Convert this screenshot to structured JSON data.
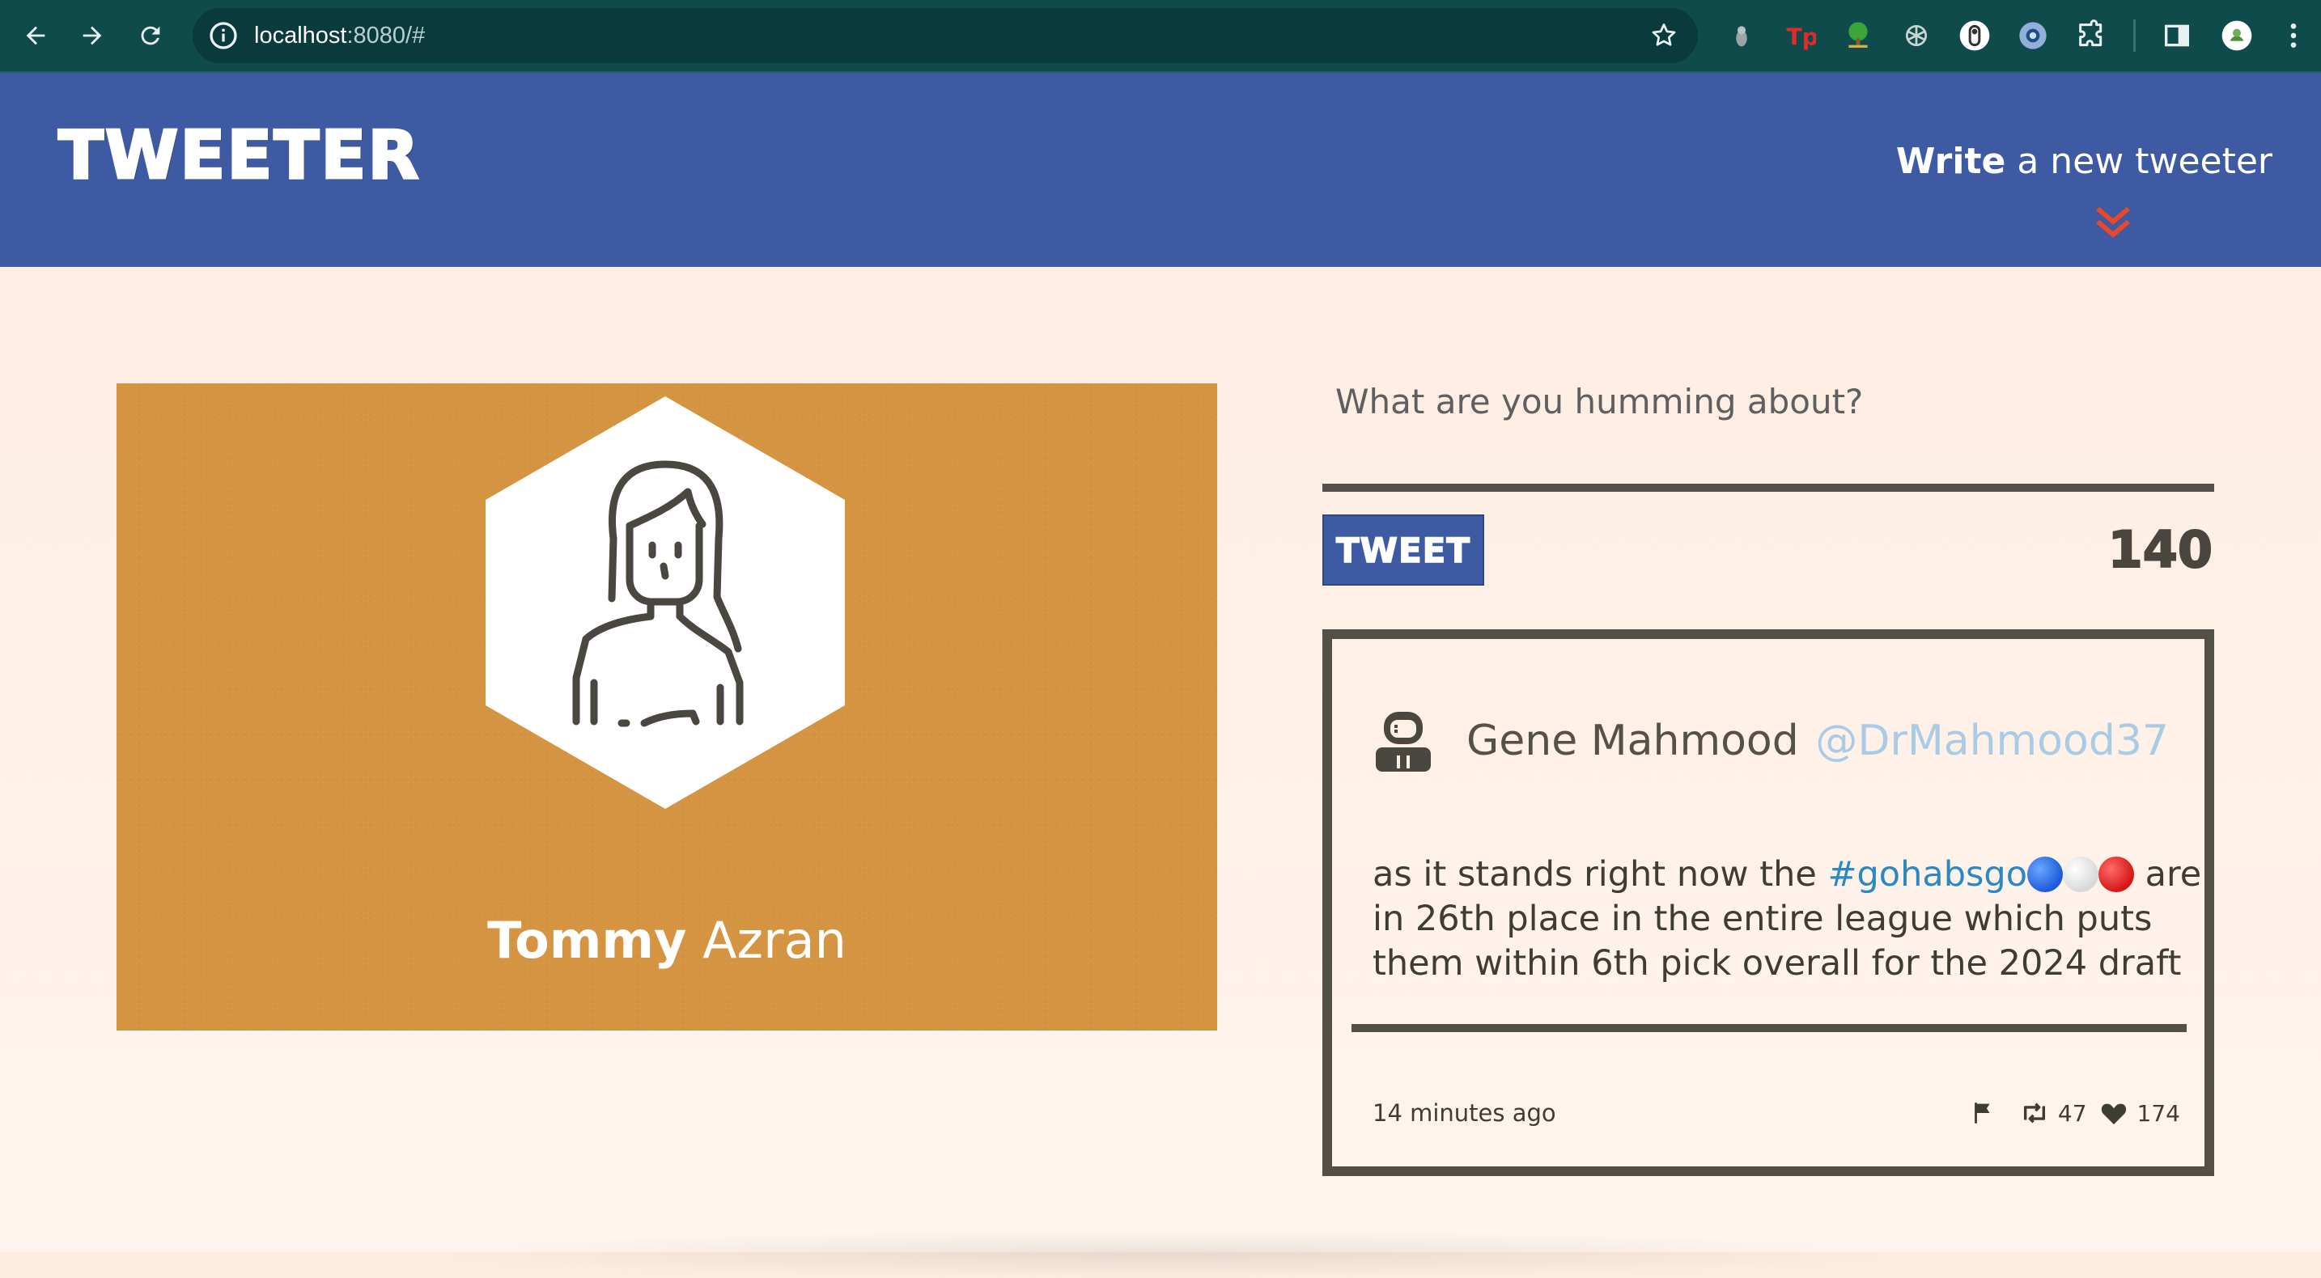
{
  "browser": {
    "url_host": "localhost",
    "url_rest": ":8080/#"
  },
  "header": {
    "logo": "TWEETER",
    "compose_toggle_bold": "Write",
    "compose_toggle_rest": " a new tweeter"
  },
  "profile": {
    "first_name": "Tommy",
    "last_name": "Azran",
    "background_color": "#d59441"
  },
  "compose": {
    "placeholder": "What are you humming about?",
    "button_label": "TWEET",
    "char_counter": "140"
  },
  "tweet": {
    "name": "Gene Mahmood",
    "handle": "@DrMahmood37",
    "text_before": "as it stands right now the ",
    "hashtag": "#gohabsgo",
    "text_after": " are",
    "line2": "in 26th place in the entire league which puts",
    "line3": "them within 6th pick overall for the 2024 draft",
    "time_ago": "14 minutes ago",
    "retweets": "47",
    "likes": "174"
  },
  "colors": {
    "header_bg": "#3d5aa3",
    "accent_chevron": "#e8472a",
    "hashtag": "#2a88c4",
    "handle": "#a8cbe6",
    "border": "#545048"
  }
}
